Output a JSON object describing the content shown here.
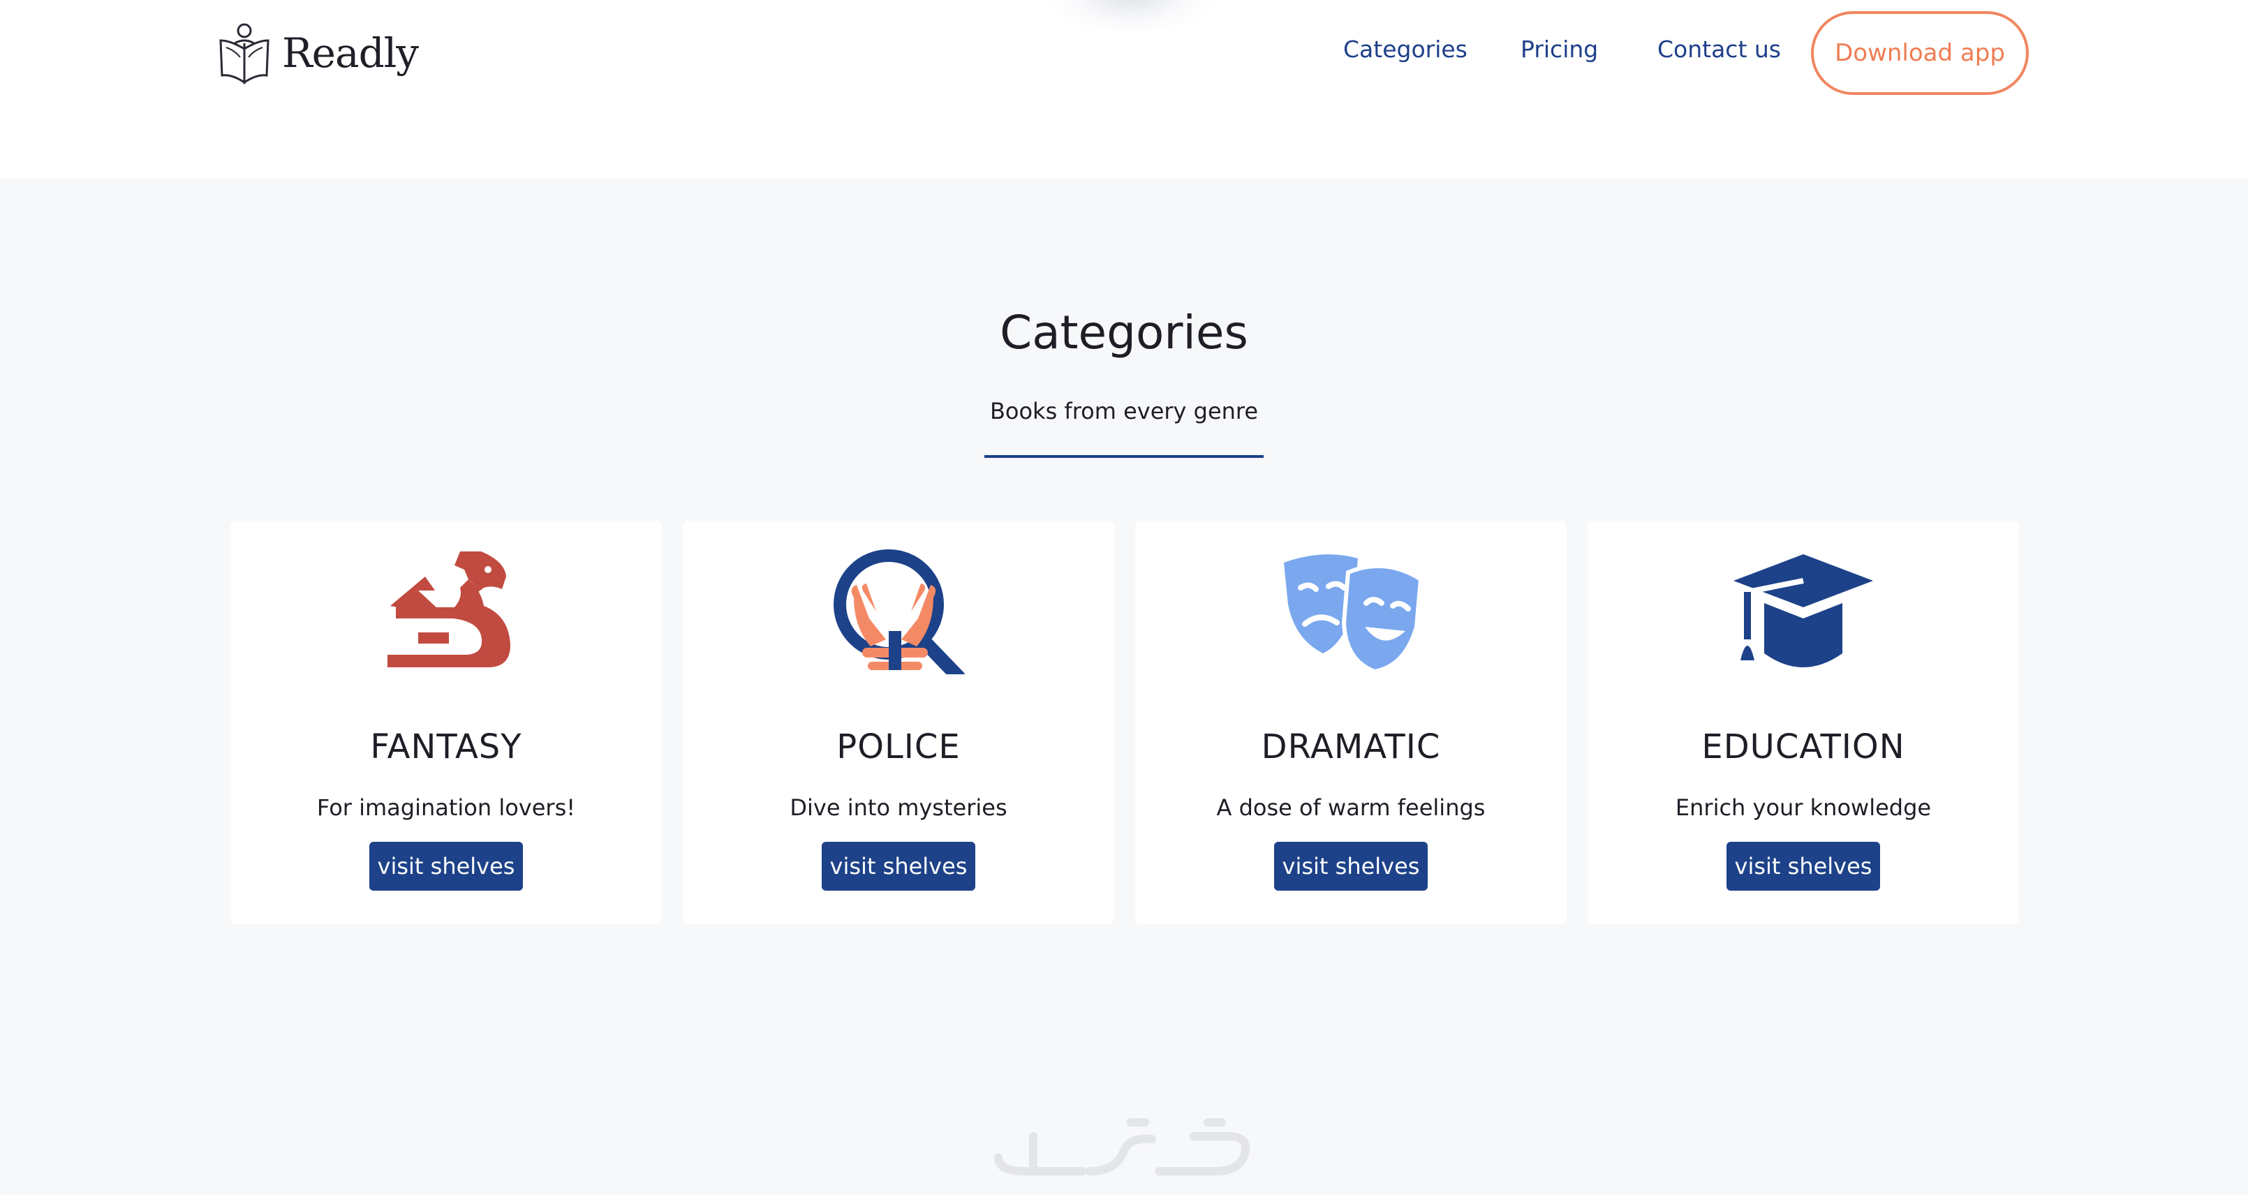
{
  "colors": {
    "primary": "#1d4289",
    "accent": "#ef7d53",
    "page_background": "#f7f8fa",
    "card_background": "#ffffff"
  },
  "header": {
    "logo_text": "Readly",
    "logo_icon": "open-book-reader-icon",
    "nav": {
      "categories": "Categories",
      "pricing": "Pricing",
      "contact": "Contact us"
    },
    "download_button": "Download app"
  },
  "section": {
    "title": "Categories",
    "subtitle": "Books from every genre"
  },
  "cards": [
    {
      "icon": "dragon-icon",
      "icon_color": "#c14b40",
      "title": "FANTASY",
      "description": "For imagination lovers!",
      "button": "visit shelves"
    },
    {
      "icon": "handcuffs-magnifier-icon",
      "icon_color": "#1d4289",
      "title": "POLICE",
      "description": "Dive into mysteries",
      "button": "visit shelves"
    },
    {
      "icon": "theater-masks-icon",
      "icon_color": "#7aa7ee",
      "title": "DRAMATIC",
      "description": "A dose of warm feelings",
      "button": "visit shelves"
    },
    {
      "icon": "graduation-cap-icon",
      "icon_color": "#1d4289",
      "title": "EDUCATION",
      "description": "Enrich your knowledge",
      "button": "visit shelves"
    }
  ]
}
